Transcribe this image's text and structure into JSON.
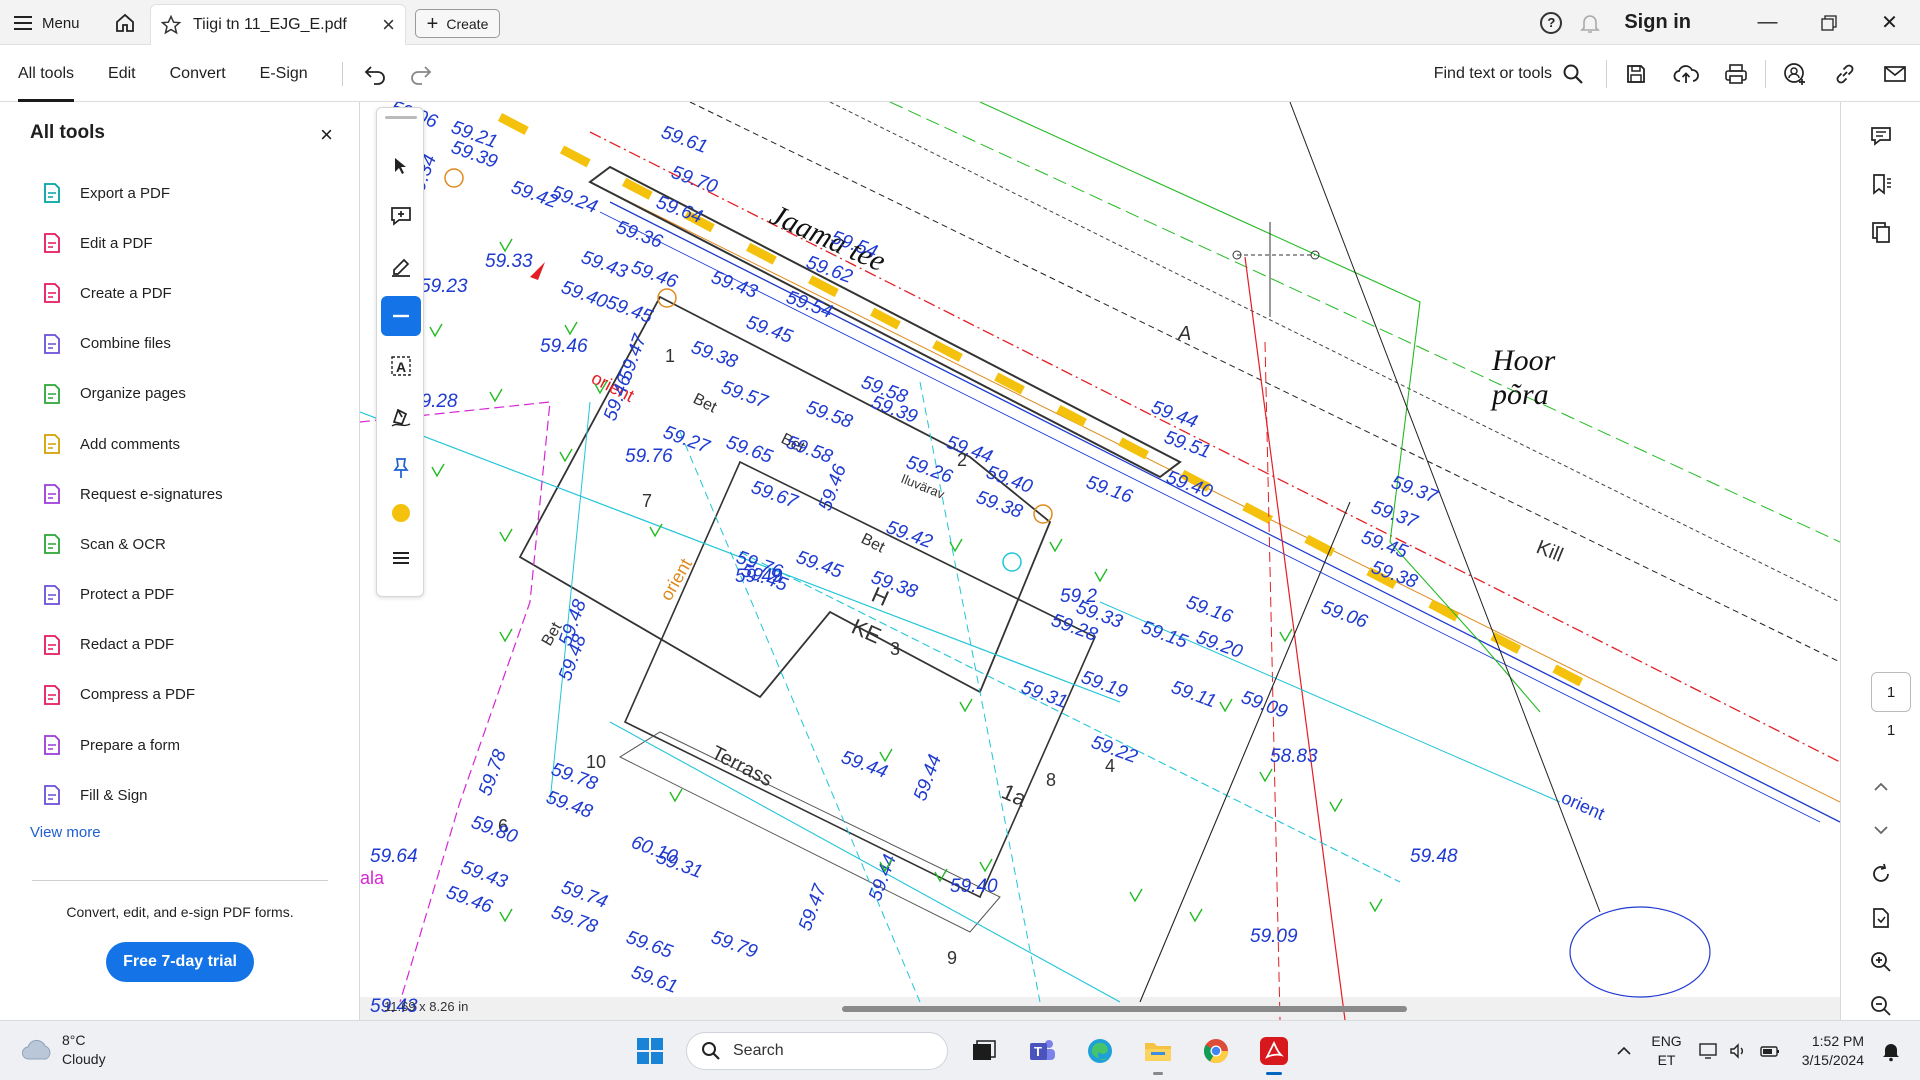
{
  "titlebar": {
    "menu_label": "Menu",
    "tab_title": "Tiigi tn 11_EJG_E.pdf",
    "create_label": "Create",
    "signin_label": "Sign in",
    "icons": [
      "hamburger-icon",
      "home-icon",
      "star-icon",
      "close-icon",
      "plus-icon",
      "help-icon",
      "bell-icon",
      "minimize-icon",
      "restore-icon",
      "close-icon"
    ]
  },
  "toolbar": {
    "tabs": [
      "All tools",
      "Edit",
      "Convert",
      "E-Sign"
    ],
    "active_tab": "All tools",
    "find_label": "Find text or tools",
    "icons": [
      "undo-icon",
      "redo-icon",
      "search-icon",
      "save-icon",
      "upload-icon",
      "print-icon",
      "share-user-icon",
      "link-icon",
      "mail-icon"
    ]
  },
  "left_panel": {
    "title": "All tools",
    "tools": [
      {
        "label": "Export a PDF",
        "icon": "export-pdf-icon",
        "color": "#00a3a3"
      },
      {
        "label": "Edit a PDF",
        "icon": "edit-pdf-icon",
        "color": "#e3195e"
      },
      {
        "label": "Create a PDF",
        "icon": "create-pdf-icon",
        "color": "#e3195e"
      },
      {
        "label": "Combine files",
        "icon": "combine-files-icon",
        "color": "#6b4fd8"
      },
      {
        "label": "Organize pages",
        "icon": "organize-pages-icon",
        "color": "#2ba636"
      },
      {
        "label": "Add comments",
        "icon": "add-comments-icon",
        "color": "#d4a100"
      },
      {
        "label": "Request e-signatures",
        "icon": "request-esign-icon",
        "color": "#9b3bd6"
      },
      {
        "label": "Scan & OCR",
        "icon": "scan-ocr-icon",
        "color": "#2ba636"
      },
      {
        "label": "Protect a PDF",
        "icon": "protect-pdf-icon",
        "color": "#6b4fd8"
      },
      {
        "label": "Redact a PDF",
        "icon": "redact-pdf-icon",
        "color": "#e3195e"
      },
      {
        "label": "Compress a PDF",
        "icon": "compress-pdf-icon",
        "color": "#e3195e"
      },
      {
        "label": "Prepare a form",
        "icon": "prepare-form-icon",
        "color": "#9b3bd6"
      },
      {
        "label": "Fill & Sign",
        "icon": "fill-sign-icon",
        "color": "#6b4fd8"
      }
    ],
    "view_more": "View more",
    "promo": "Convert, edit, and e-sign PDF forms.",
    "trial_button": "Free 7-day trial"
  },
  "quick_tools": {
    "icons": [
      "select-cursor-icon",
      "add-comment-icon",
      "highlight-pen-icon",
      "line-tool-icon",
      "text-box-icon",
      "draw-signature-icon",
      "pin-icon",
      "color-dot-icon",
      "more-options-icon"
    ],
    "active": "line-tool-icon",
    "color": "#f4c20d"
  },
  "document": {
    "page_size": "11.69 x 8.26 in",
    "labels": {
      "road": "Jaama tee",
      "hoor": "Hoor",
      "pora": "põra",
      "a": "A",
      "kill": "Kill",
      "orient1": "orient",
      "orient2": "orient",
      "orient3": "orient",
      "bet1": "Bet",
      "bet2": "Bet",
      "bet3": "Bet",
      "bet4": "Bet",
      "iluvarav": "Iluvärav",
      "h": "H",
      "ke": "KE",
      "terrass": "Terrass",
      "ala": "ala",
      "n1": "1",
      "n2": "2",
      "n3": "3",
      "n4": "4",
      "n6": "6",
      "n7": "7",
      "n8": "8",
      "n9": "9",
      "n10": "10",
      "n1a": "1a"
    },
    "elevations": [
      "59.06",
      "59.21",
      "59.39",
      "59.34",
      "59.42",
      "59.24",
      "59.61",
      "59.70",
      "59.64",
      "59.36",
      "59.33",
      "59.43",
      "59.46",
      "59.23",
      "59.40",
      "59.45",
      "59.43",
      "59.54",
      "59.62",
      "59.54",
      "59.45",
      "59.47",
      "59.46",
      "59.38",
      "59.57",
      "59.58",
      "59.39",
      "59.28",
      "59.27",
      "59.65",
      "59.58",
      "59.58",
      "59.44",
      "59.26",
      "59.38",
      "59.76",
      "59.46",
      "59.45",
      "59.38",
      "59.40",
      "59.67",
      "59.76",
      "59.49",
      "59.46",
      "59.48",
      "59.45",
      "59.48",
      "59.42",
      "59.33",
      "59.15",
      "59.16",
      "59.20",
      "59.28",
      "59.37",
      "59.44",
      "59.51",
      "59.40",
      "59.16",
      "59.37",
      "59.45",
      "59.38",
      "59.06",
      "59.09",
      "59.11",
      "59.19",
      "59.31",
      "59.22",
      "59.78",
      "59.78",
      "59.48",
      "59.44",
      "59.44",
      "59.80",
      "60.10",
      "59.31",
      "59.64",
      "59.43",
      "59.46",
      "59.78",
      "59.74",
      "59.65",
      "59.79",
      "59.47",
      "59.44",
      "59.40",
      "59.48",
      "59.09",
      "58.83",
      "59.61",
      "59.2",
      "59.43"
    ]
  },
  "right_rail": {
    "icons": [
      "comment-icon",
      "bookmark-icon",
      "copy-pages-icon",
      "chevron-up-icon",
      "chevron-down-icon",
      "refresh-icon",
      "page-icon",
      "zoom-in-icon",
      "zoom-out-icon"
    ],
    "current_page": "1",
    "total_pages": "1"
  },
  "taskbar": {
    "temperature": "8°C",
    "condition": "Cloudy",
    "search_label": "Search",
    "lang_top": "ENG",
    "lang_bottom": "ET",
    "time": "1:52 PM",
    "date": "3/15/2024",
    "apps": [
      "windows-start-icon",
      "task-view-icon",
      "teams-icon",
      "edge-icon",
      "file-explorer-icon",
      "chrome-icon",
      "acrobat-icon"
    ],
    "tray": [
      "chevron-up-icon",
      "monitor-icon",
      "volume-icon",
      "battery-icon",
      "notification-icon"
    ]
  }
}
